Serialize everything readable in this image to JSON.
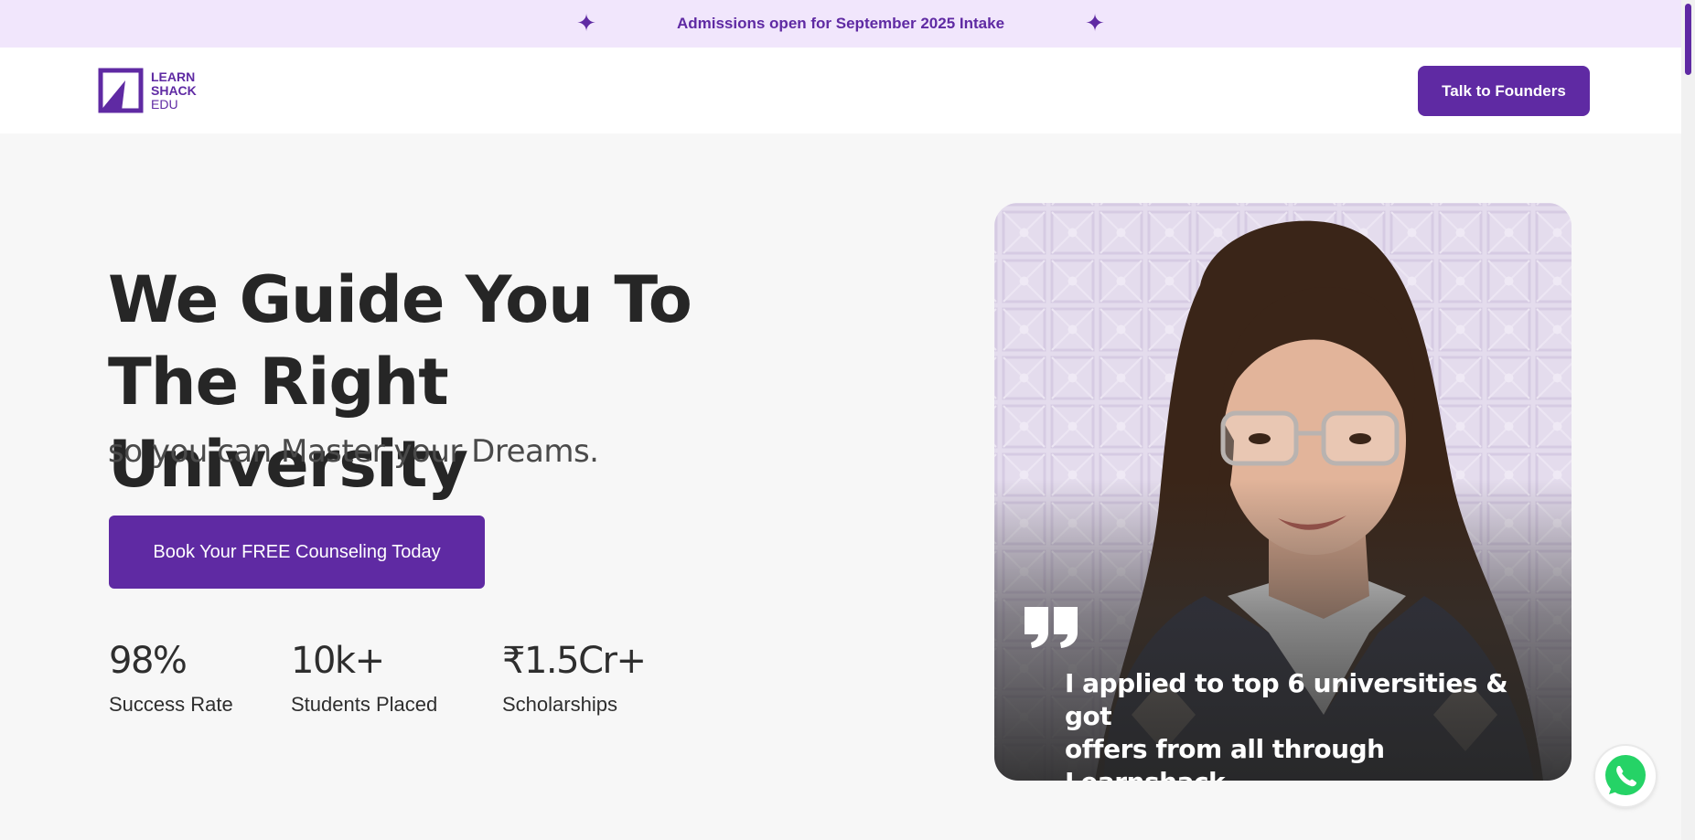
{
  "announcement": {
    "text": "Admissions open for September 2025 Intake",
    "icon_left": "sparkle-icon",
    "icon_right": "sparkle-icon"
  },
  "header": {
    "logo": {
      "line1": "LEARN",
      "line2": "SHACK",
      "line3": "EDU"
    },
    "cta_label": "Talk to Founders"
  },
  "hero": {
    "title_line1": "We Guide You To",
    "title_line2": "The Right University",
    "subtitle": "so you can Master your Dreams.",
    "cta_label": "Book Your FREE Counseling Today",
    "stats": [
      {
        "value": "98%",
        "label": "Success Rate"
      },
      {
        "value": "10k+",
        "label": "Students Placed"
      },
      {
        "value": "₹1.5Cr+",
        "label": "Scholarships"
      }
    ]
  },
  "testimonial": {
    "quote_line1": "I applied to top 6 universities & got",
    "quote_line2": "offers from all through Learnshack."
  },
  "colors": {
    "brand": "#5f2aa3",
    "announce_bg": "#f1e6fc",
    "page_bg": "#f7f7f7",
    "whatsapp_green": "#25d366"
  },
  "icons": {
    "quote": "quote-icon",
    "whatsapp": "whatsapp-icon",
    "logo": "learnshack-logo-icon"
  }
}
